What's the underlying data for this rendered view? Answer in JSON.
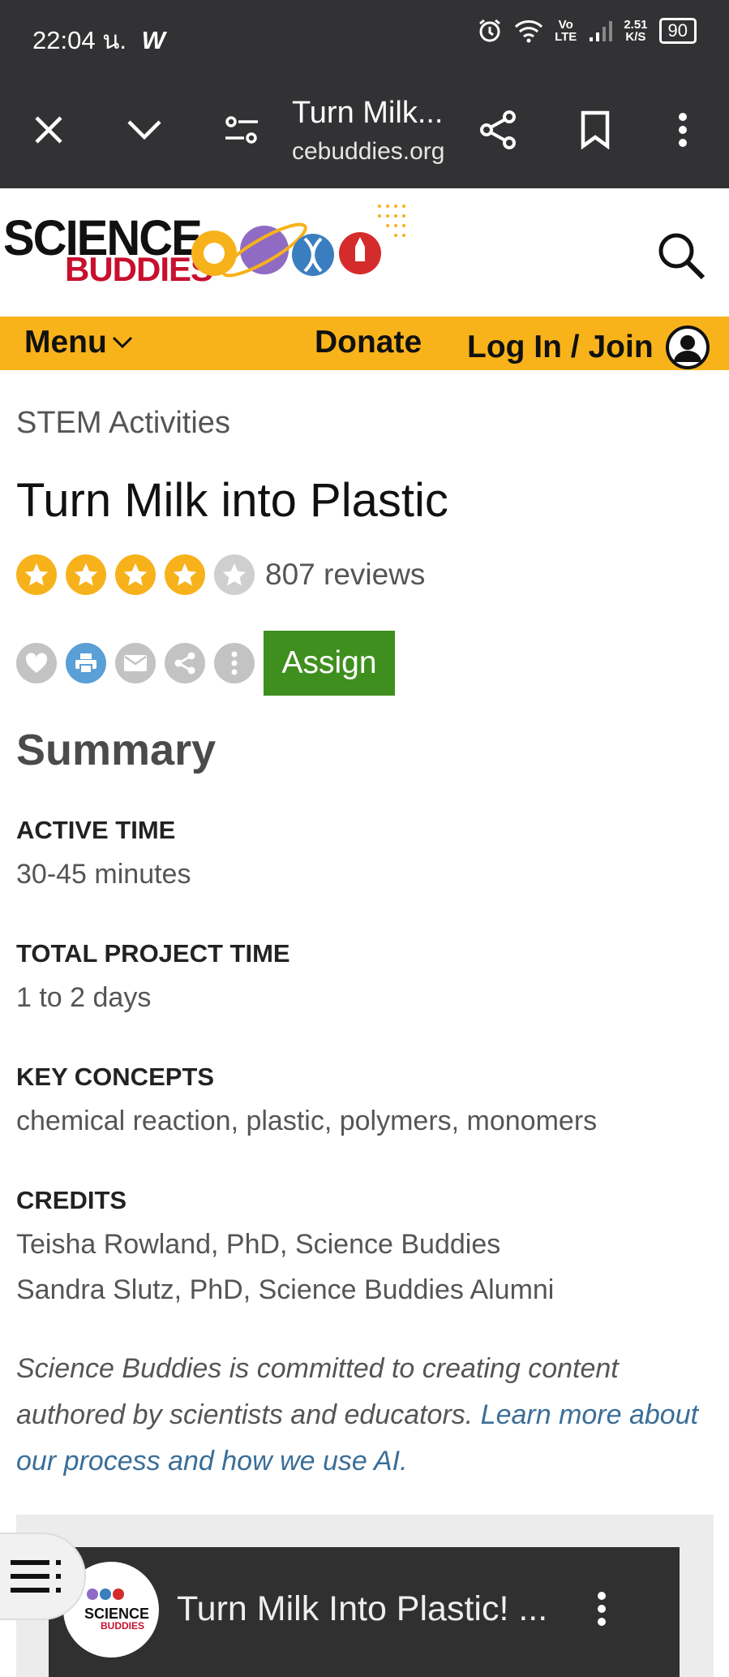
{
  "status_bar": {
    "time": "22:04 น.",
    "app_badge": "W",
    "net_top": "Vo",
    "net_bottom": "LTE",
    "speed_top": "2.51",
    "speed_bottom": "K/S",
    "battery": "90"
  },
  "browser": {
    "title": "Turn Milk...",
    "domain": "cebuddies.org"
  },
  "site": {
    "logo_line1": "SCIENCE",
    "logo_line2": "BUDDIES"
  },
  "nav": {
    "menu": "Menu",
    "donate": "Donate",
    "login": "Log In / Join"
  },
  "breadcrumb": "STEM Activities",
  "title": "Turn Milk into Plastic",
  "rating": {
    "stars": 4,
    "max": 5,
    "reviews": "807 reviews"
  },
  "actions": {
    "assign": "Assign"
  },
  "summary": {
    "heading": "Summary",
    "active_time_label": "ACTIVE TIME",
    "active_time": "30-45 minutes",
    "total_time_label": "TOTAL PROJECT TIME",
    "total_time": "1 to 2 days",
    "key_concepts_label": "KEY CONCEPTS",
    "key_concepts": "chemical reaction, plastic, polymers, monomers",
    "credits_label": "CREDITS",
    "credit_1": "Teisha Rowland, PhD, Science Buddies",
    "credit_2": "Sandra Slutz, PhD, Science Buddies Alumni"
  },
  "note": {
    "text": "Science Buddies is committed to creating content authored by scientists and educators. ",
    "link": "Learn more about our process and how we use AI."
  },
  "video": {
    "title": "Turn Milk Into Plastic! ...",
    "logo_line1": "SCIENCE",
    "logo_line2": "BUDDIES"
  },
  "colors": {
    "nav_bg": "#f8b31b",
    "star": "#f7b21b",
    "assign_bg": "#3f8f1f",
    "link": "#3a6e98",
    "chrome_bg": "#323234"
  }
}
